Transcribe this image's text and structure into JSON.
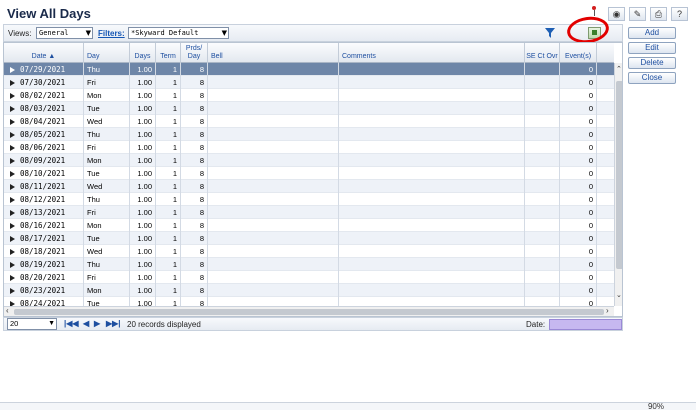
{
  "header": {
    "title": "View All Days"
  },
  "toolbar": {
    "views_label": "Views:",
    "views_value": "General",
    "filters_label": "Filters:",
    "filters_value": "*Skyward Default"
  },
  "grid": {
    "columns": [
      "Date ▲",
      "Day",
      "Days",
      "Term",
      "Prds/ Day",
      "Bell",
      "Comments",
      "SE Ct Ovr",
      "Event(s)"
    ],
    "rows": [
      {
        "date": "07/29/2021",
        "day": "Thu",
        "days": "1.00",
        "term": "1",
        "prds": "8",
        "bell": "",
        "comments": "",
        "se": "",
        "events": "0"
      },
      {
        "date": "07/30/2021",
        "day": "Fri",
        "days": "1.00",
        "term": "1",
        "prds": "8",
        "bell": "",
        "comments": "",
        "se": "",
        "events": "0"
      },
      {
        "date": "08/02/2021",
        "day": "Mon",
        "days": "1.00",
        "term": "1",
        "prds": "8",
        "bell": "",
        "comments": "",
        "se": "",
        "events": "0"
      },
      {
        "date": "08/03/2021",
        "day": "Tue",
        "days": "1.00",
        "term": "1",
        "prds": "8",
        "bell": "",
        "comments": "",
        "se": "",
        "events": "0"
      },
      {
        "date": "08/04/2021",
        "day": "Wed",
        "days": "1.00",
        "term": "1",
        "prds": "8",
        "bell": "",
        "comments": "",
        "se": "",
        "events": "0"
      },
      {
        "date": "08/05/2021",
        "day": "Thu",
        "days": "1.00",
        "term": "1",
        "prds": "8",
        "bell": "",
        "comments": "",
        "se": "",
        "events": "0"
      },
      {
        "date": "08/06/2021",
        "day": "Fri",
        "days": "1.00",
        "term": "1",
        "prds": "8",
        "bell": "",
        "comments": "",
        "se": "",
        "events": "0"
      },
      {
        "date": "08/09/2021",
        "day": "Mon",
        "days": "1.00",
        "term": "1",
        "prds": "8",
        "bell": "",
        "comments": "",
        "se": "",
        "events": "0"
      },
      {
        "date": "08/10/2021",
        "day": "Tue",
        "days": "1.00",
        "term": "1",
        "prds": "8",
        "bell": "",
        "comments": "",
        "se": "",
        "events": "0"
      },
      {
        "date": "08/11/2021",
        "day": "Wed",
        "days": "1.00",
        "term": "1",
        "prds": "8",
        "bell": "",
        "comments": "",
        "se": "",
        "events": "0"
      },
      {
        "date": "08/12/2021",
        "day": "Thu",
        "days": "1.00",
        "term": "1",
        "prds": "8",
        "bell": "",
        "comments": "",
        "se": "",
        "events": "0"
      },
      {
        "date": "08/13/2021",
        "day": "Fri",
        "days": "1.00",
        "term": "1",
        "prds": "8",
        "bell": "",
        "comments": "",
        "se": "",
        "events": "0"
      },
      {
        "date": "08/16/2021",
        "day": "Mon",
        "days": "1.00",
        "term": "1",
        "prds": "8",
        "bell": "",
        "comments": "",
        "se": "",
        "events": "0"
      },
      {
        "date": "08/17/2021",
        "day": "Tue",
        "days": "1.00",
        "term": "1",
        "prds": "8",
        "bell": "",
        "comments": "",
        "se": "",
        "events": "0"
      },
      {
        "date": "08/18/2021",
        "day": "Wed",
        "days": "1.00",
        "term": "1",
        "prds": "8",
        "bell": "",
        "comments": "",
        "se": "",
        "events": "0"
      },
      {
        "date": "08/19/2021",
        "day": "Thu",
        "days": "1.00",
        "term": "1",
        "prds": "8",
        "bell": "",
        "comments": "",
        "se": "",
        "events": "0"
      },
      {
        "date": "08/20/2021",
        "day": "Fri",
        "days": "1.00",
        "term": "1",
        "prds": "8",
        "bell": "",
        "comments": "",
        "se": "",
        "events": "0"
      },
      {
        "date": "08/23/2021",
        "day": "Mon",
        "days": "1.00",
        "term": "1",
        "prds": "8",
        "bell": "",
        "comments": "",
        "se": "",
        "events": "0"
      },
      {
        "date": "08/24/2021",
        "day": "Tue",
        "days": "1.00",
        "term": "1",
        "prds": "8",
        "bell": "",
        "comments": "",
        "se": "",
        "events": "0"
      }
    ]
  },
  "footer": {
    "page_size": "20",
    "records_text": "20 records displayed",
    "date_label": "Date:",
    "date_value": ""
  },
  "side_buttons": {
    "add": "Add",
    "edit": "Edit",
    "delete": "Delete",
    "close": "Close"
  },
  "status": {
    "zoom": "90%"
  },
  "icons": {
    "top": [
      "pin-icon",
      "camera-icon",
      "notes-icon",
      "print-icon",
      "help-icon"
    ],
    "toolbar": [
      "funnel-icon",
      "export-icon"
    ]
  },
  "colors": {
    "selected_row": "#6e86a8",
    "alt_row": "#eef2f8",
    "date_input": "#c6b8f0",
    "annotation_circle": "#e20000",
    "link": "#1556b4"
  }
}
